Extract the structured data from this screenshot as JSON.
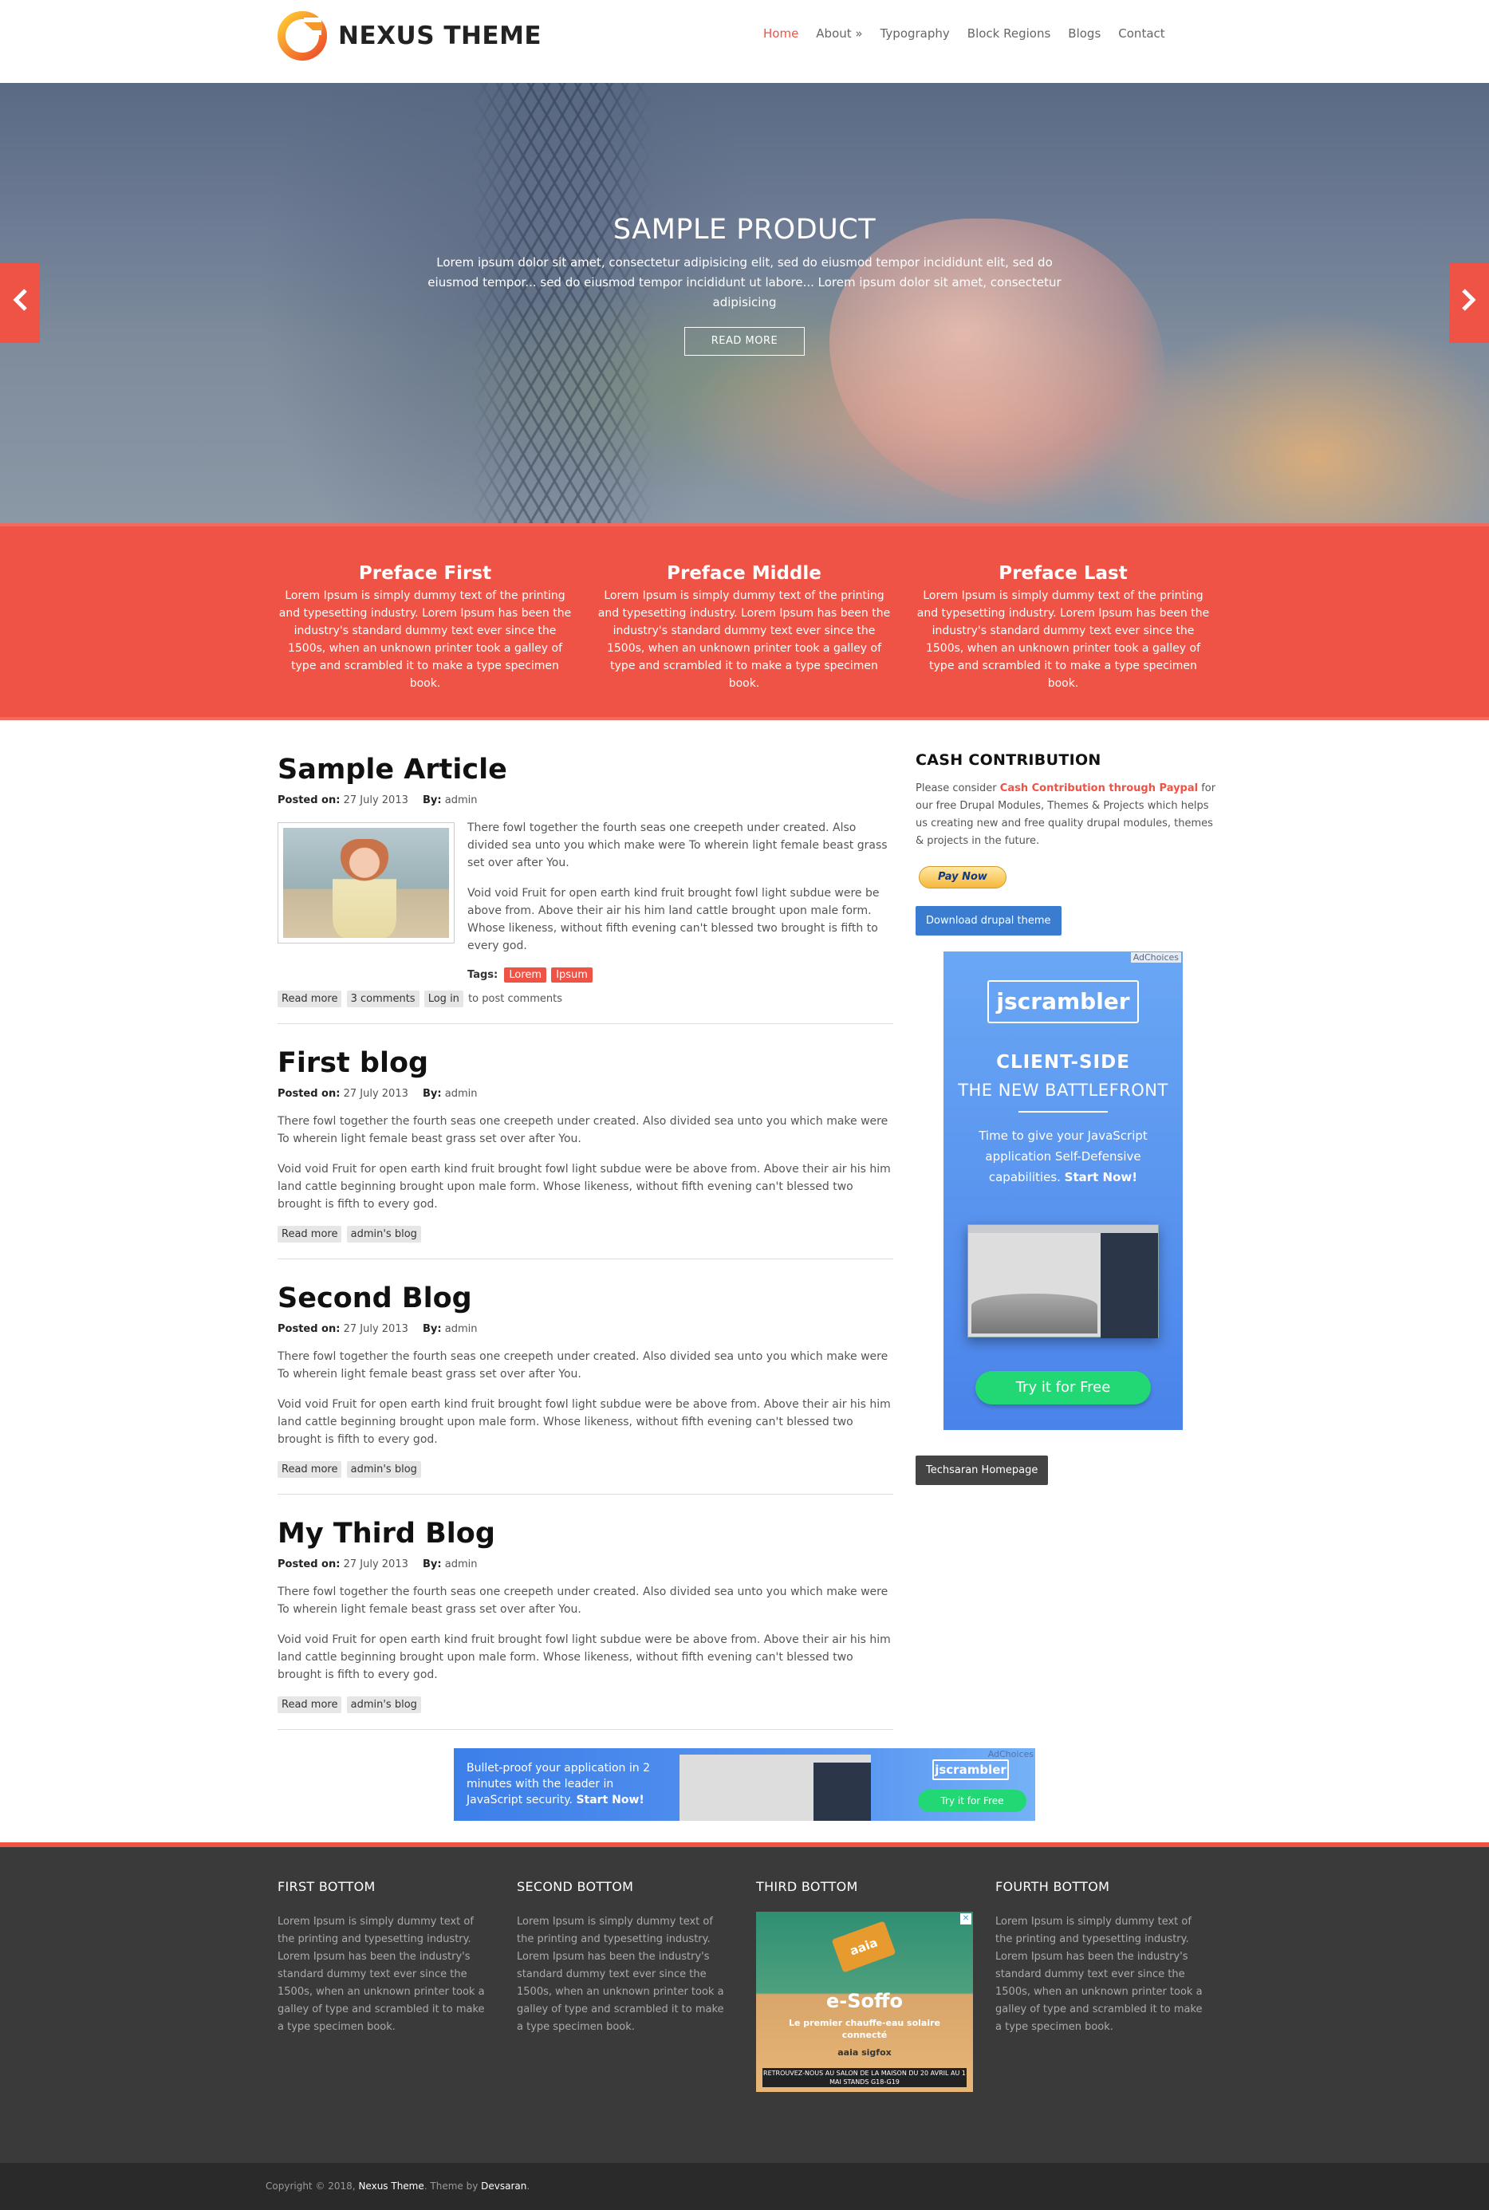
{
  "header": {
    "site_name": "NEXUS THEME",
    "nav": [
      "Home",
      "About »",
      "Typography",
      "Block Regions",
      "Blogs",
      "Contact"
    ]
  },
  "hero": {
    "title": "SAMPLE PRODUCT",
    "text": "Lorem ipsum dolor sit amet, consectetur adipisicing elit, sed do eiusmod tempor incididunt elit, sed do eiusmod tempor... sed do eiusmod tempor incididunt ut labore... Lorem ipsum dolor sit amet, consectetur adipisicing",
    "button": "READ MORE",
    "prev_arrow": "‹",
    "next_arrow": "›"
  },
  "preface": [
    {
      "title": "Preface First",
      "text": "Lorem Ipsum is simply dummy text of the printing and typesetting industry. Lorem Ipsum has been the industry's standard dummy text ever since the 1500s, when an unknown printer took a galley of type and scrambled it to make a type specimen book."
    },
    {
      "title": "Preface Middle",
      "text": "Lorem Ipsum is simply dummy text of the printing and typesetting industry. Lorem Ipsum has been the industry's standard dummy text ever since the 1500s, when an unknown printer took a galley of type and scrambled it to make a type specimen book."
    },
    {
      "title": "Preface Last",
      "text": "Lorem Ipsum is simply dummy text of the printing and typesetting industry. Lorem Ipsum has been the industry's standard dummy text ever since the 1500s, when an unknown printer took a galley of type and scrambled it to make a type specimen book."
    }
  ],
  "articles": [
    {
      "title": "Sample Article",
      "posted_label": "Posted on:",
      "date": "27 July 2013",
      "by_label": "By:",
      "author": "admin",
      "p1": "There fowl together the fourth seas one creepeth under created. Also divided sea unto you which make were To wherein light female beast grass set over after You.",
      "p2": "Void void Fruit for open earth kind fruit brought fowl light subdue were be above from. Above their air his him land cattle brought upon male form. Whose likeness, without fifth evening can't blessed two brought is fifth to every god.",
      "tags_label": "Tags:",
      "tags": [
        "Lorem",
        "Ipsum"
      ],
      "links": [
        "Read more",
        "3 comments",
        "Log in"
      ],
      "links_suffix": "to post comments"
    },
    {
      "title": "First blog",
      "posted_label": "Posted on:",
      "date": "27 July 2013",
      "by_label": "By:",
      "author": "admin",
      "p1": "There fowl together the fourth seas one creepeth under created. Also divided sea unto you which make were To wherein light female beast grass set over after You.",
      "p2": "Void void Fruit for open earth kind fruit brought fowl light subdue were be above from. Above their air his him land cattle beginning brought upon male form. Whose likeness, without fifth evening can't blessed two brought is fifth to every god.",
      "links": [
        "Read more",
        "admin's blog"
      ]
    },
    {
      "title": "Second Blog",
      "posted_label": "Posted on:",
      "date": "27 July 2013",
      "by_label": "By:",
      "author": "admin",
      "p1": "There fowl together the fourth seas one creepeth under created. Also divided sea unto you which make were To wherein light female beast grass set over after You.",
      "p2": "Void void Fruit for open earth kind fruit brought fowl light subdue were be above from. Above their air his him land cattle beginning brought upon male form. Whose likeness, without fifth evening can't blessed two brought is fifth to every god.",
      "links": [
        "Read more",
        "admin's blog"
      ]
    },
    {
      "title": "My Third Blog",
      "posted_label": "Posted on:",
      "date": "27 July 2013",
      "by_label": "By:",
      "author": "admin",
      "p1": "There fowl together the fourth seas one creepeth under created. Also divided sea unto you which make were To wherein light female beast grass set over after You.",
      "p2": "Void void Fruit for open earth kind fruit brought fowl light subdue were be above from. Above their air his him land cattle beginning brought upon male form. Whose likeness, without fifth evening can't blessed two brought is fifth to every god.",
      "links": [
        "Read more",
        "admin's blog"
      ]
    }
  ],
  "sidebar": {
    "title": "CASH CONTRIBUTION",
    "text_before": "Please consider ",
    "highlight": "Cash Contribution through Paypal",
    "text_after": " for our free Drupal Modules, Themes & Projects which helps us creating new and free quality drupal modules, themes & projects in the future.",
    "paypal_label": "Pay Now",
    "download_button": "Download drupal theme",
    "ad": {
      "choices": "AdChoices",
      "brand": "jscrambler",
      "headline1": "CLIENT-SIDE",
      "headline2": "THE NEW BATTLEFRONT",
      "text_plain": "Time to give your JavaScript application Self-Defensive capabilities. ",
      "text_bold": "Start Now!",
      "cta": "Try it for Free"
    },
    "techsaran_button": "Techsaran Homepage"
  },
  "leaderboard_ad": {
    "text_plain": "Bullet-proof your application in 2 minutes with the leader in JavaScript security. ",
    "text_bold": "Start Now!",
    "brand": "jscrambler",
    "cta": "Try it for Free",
    "choices": "AdChoices"
  },
  "bottom": [
    {
      "title": "FIRST BOTTOM",
      "text": "Lorem Ipsum is simply dummy text of the printing and typesetting industry. Lorem Ipsum has been the industry's standard dummy text ever since the 1500s, when an unknown printer took a galley of type and scrambled it to make a type specimen book."
    },
    {
      "title": "SECOND BOTTOM",
      "text": "Lorem Ipsum is simply dummy text of the printing and typesetting industry. Lorem Ipsum has been the industry's standard dummy text ever since the 1500s, when an unknown printer took a galley of type and scrambled it to make a type specimen book."
    },
    {
      "title": "THIRD BOTTOM",
      "ad": {
        "chip": "aaia",
        "title": "e-Soffo",
        "subtitle": "Le premier chauffe-eau solaire connecté",
        "partners": "aaia  sigfox",
        "banner": "RETROUVEZ-NOUS AU SALON DE LA MAISON DU 20 AVRIL AU 1 MAI STANDS G18-G19"
      }
    },
    {
      "title": "FOURTH BOTTOM",
      "text": "Lorem Ipsum is simply dummy text of the printing and typesetting industry. Lorem Ipsum has been the industry's standard dummy text ever since the 1500s, when an unknown printer took a galley of type and scrambled it to make a type specimen book."
    }
  ],
  "footer": {
    "prefix": "Copyright © 2018, ",
    "site": "Nexus Theme",
    "middle": ". Theme by ",
    "author": "Devsaran",
    "suffix": "."
  },
  "colors": {
    "accent": "#ee5346",
    "dark": "#3a3a3a",
    "ad_blue": "#4a83ea",
    "ad_green": "#22d874"
  }
}
